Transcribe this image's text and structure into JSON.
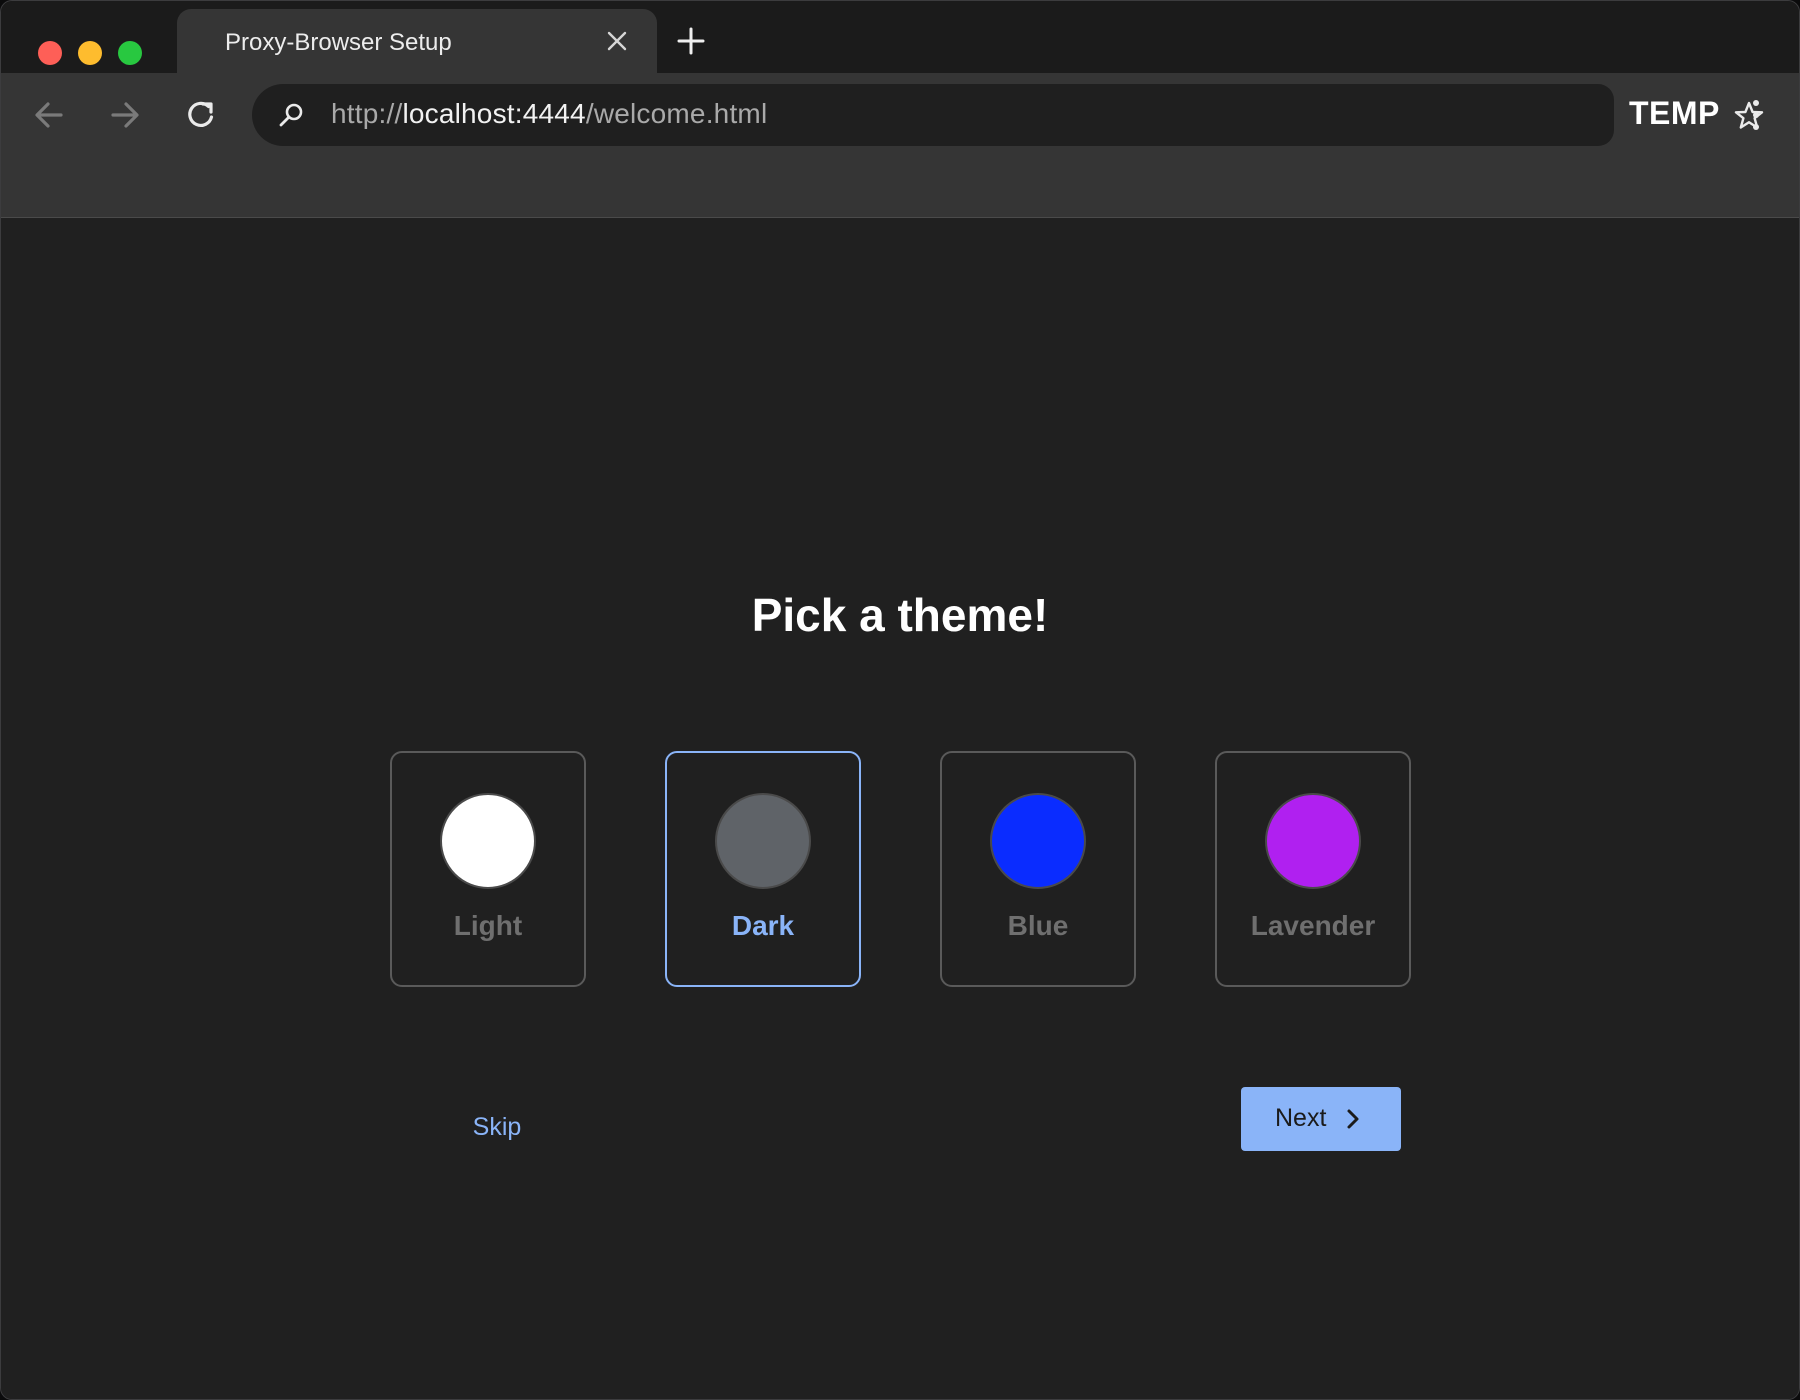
{
  "window": {
    "traffic_lights": [
      "close",
      "minimize",
      "zoom"
    ]
  },
  "tab": {
    "title": "Proxy-Browser Setup",
    "close_icon": "close-icon",
    "new_tab_icon": "plus-icon"
  },
  "toolbar": {
    "back_icon": "arrow-left-icon",
    "forward_icon": "arrow-right-icon",
    "reload_icon": "reload-icon",
    "url": {
      "scheme": "http://",
      "host": "localhost:4444",
      "path": "/welcome.html"
    },
    "bookmark_icon": "star-icon",
    "shield_icon": "shield-icon",
    "profile_label": "TEMP",
    "menu_icon": "kebab-menu-icon"
  },
  "setup": {
    "heading": "Pick a theme!",
    "themes": [
      {
        "label": "Light",
        "color": "#ffffff",
        "selected": false
      },
      {
        "label": "Dark",
        "color": "#5f6368",
        "selected": true
      },
      {
        "label": "Blue",
        "color": "#0a2cff",
        "selected": false
      },
      {
        "label": "Lavender",
        "color": "#b020f0",
        "selected": false
      }
    ],
    "skip_label": "Skip",
    "next_label": "Next",
    "accent_color": "#8ab4f8"
  }
}
